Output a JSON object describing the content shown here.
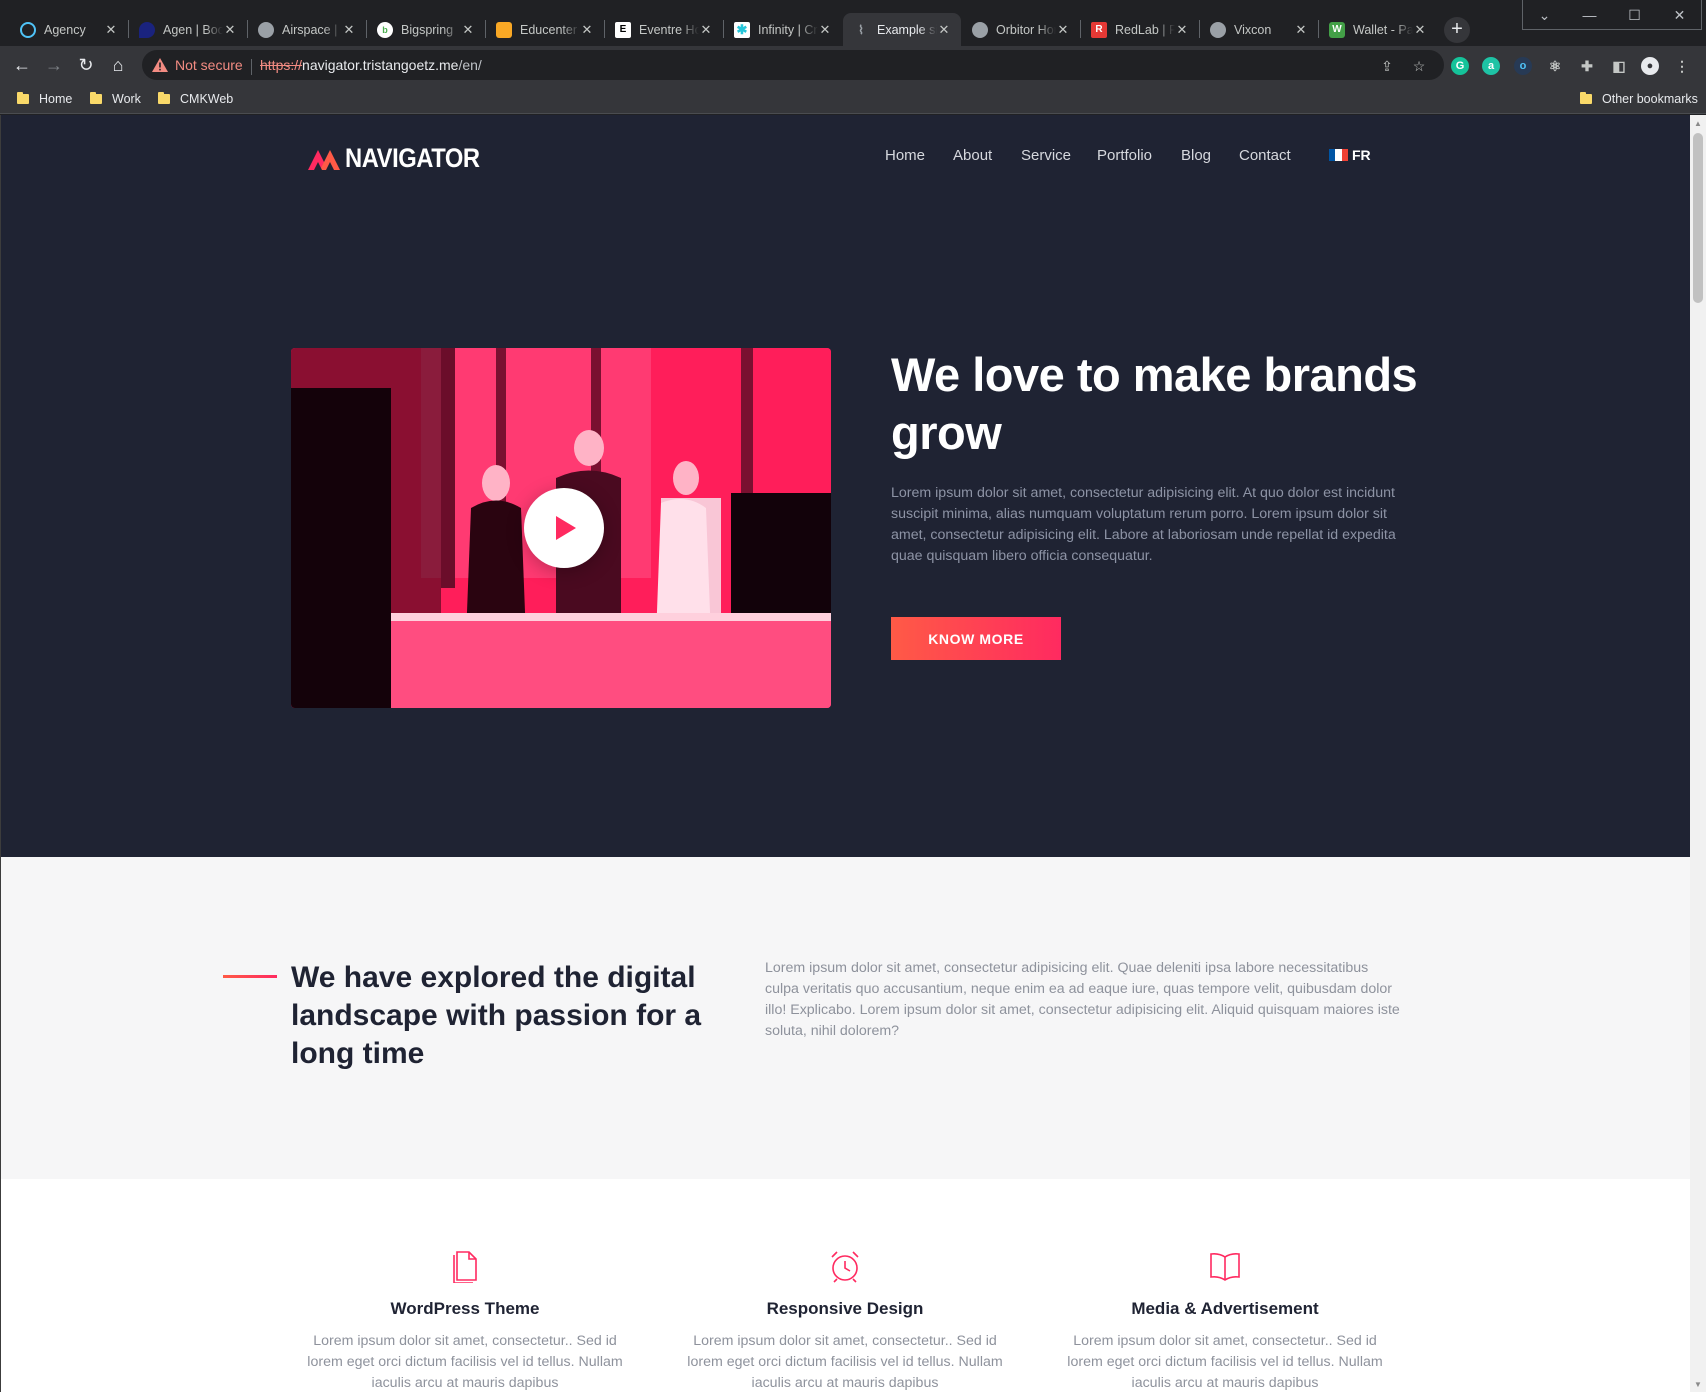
{
  "browser": {
    "tabs": [
      {
        "title": "Agency",
        "favicon": "agency-globe-icon",
        "color": "#4fc3f7"
      },
      {
        "title": "Agen | Bootstrap",
        "favicon": "pin-icon",
        "color": "#1a237e"
      },
      {
        "title": "Airspace | ",
        "favicon": "globe-icon",
        "color": "#9aa0a6"
      },
      {
        "title": "Bigspring",
        "favicon": "bigspring-icon",
        "color": "#ffffff"
      },
      {
        "title": "Educenter Home",
        "favicon": "box-icon",
        "color": "#f9a825"
      },
      {
        "title": "Eventre Home",
        "favicon": "eventre-e-icon",
        "color": "#ffffff"
      },
      {
        "title": "Infinity | Creative",
        "favicon": "asterisk-icon",
        "color": "#26c6da"
      },
      {
        "title": "Example site",
        "favicon": "pulse-icon",
        "color": "#9aa0a6",
        "active": true
      },
      {
        "title": "Orbitor Home",
        "favicon": "globe-icon",
        "color": "#9aa0a6"
      },
      {
        "title": "RedLab | Free",
        "favicon": "redlab-r-icon",
        "color": "#e53935"
      },
      {
        "title": "Vixcon",
        "favicon": "globe-icon",
        "color": "#9aa0a6"
      },
      {
        "title": "Wallet - Payment",
        "favicon": "wallet-icon",
        "color": "#43a047"
      }
    ],
    "security": "Not secure",
    "url_scheme": "https://",
    "url_host": "navigator.tristangoetz.me",
    "url_path": "/en/",
    "bookmarks": [
      "Home",
      "Work",
      "CMKWeb"
    ],
    "other_bookmarks": "Other bookmarks"
  },
  "site": {
    "logo": "NAVIGATOR",
    "nav": [
      "Home",
      "About",
      "Service",
      "Portfolio",
      "Blog",
      "Contact"
    ],
    "lang": "FR",
    "hero": {
      "title": "We love to make brands grow",
      "text": "Lorem ipsum dolor sit amet, consectetur adipisicing elit. At quo dolor est incidunt suscipit minima, alias numquam voluptatum rerum porro. Lorem ipsum dolor sit amet, consectetur adipisicing elit. Labore at laboriosam unde repellat id expedita quae quisquam libero officia consequatur.",
      "button": "KNOW MORE"
    },
    "about": {
      "title": "We have explored the digital landscape with passion for a long time",
      "text": "Lorem ipsum dolor sit amet, consectetur adipisicing elit. Quae deleniti ipsa labore necessitatibus culpa veritatis quo accusantium, neque enim ea ad eaque iure, quas tempore velit, quibusdam dolor illo! Explicabo. Lorem ipsum dolor sit amet, consectetur adipisicing elit. Aliquid quisquam maiores iste soluta, nihil dolorem?"
    },
    "services": [
      {
        "title": "WordPress Theme",
        "icon": "document-icon",
        "text": "Lorem ipsum dolor sit amet, consectetur.. Sed id lorem eget orci dictum facilisis vel id tellus. Nullam iaculis arcu at mauris dapibus"
      },
      {
        "title": "Responsive Design",
        "icon": "alarm-clock-icon",
        "text": "Lorem ipsum dolor sit amet, consectetur.. Sed id lorem eget orci dictum facilisis vel id tellus. Nullam iaculis arcu at mauris dapibus"
      },
      {
        "title": "Media & Advertisement",
        "icon": "open-book-icon",
        "text": "Lorem ipsum dolor sit amet, consectetur.. Sed id lorem eget orci dictum facilisis vel id tellus. Nullam iaculis arcu at mauris dapibus"
      }
    ],
    "colors": {
      "accent": "#ff2a60",
      "hero_bg": "#1f2333",
      "about_bg": "#f6f6f7"
    }
  }
}
